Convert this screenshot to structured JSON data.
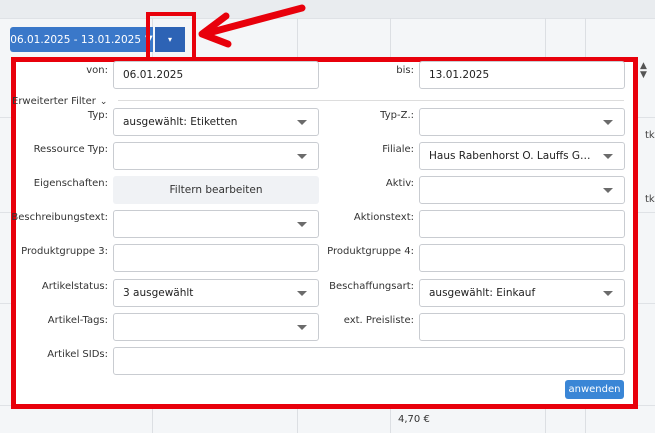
{
  "toolbar": {
    "date_range": "06.01.2025 - 13.01.2025",
    "funnel_icon": "▼",
    "caret_icon": "▾"
  },
  "background": {
    "right_text_1": "tk",
    "right_text_2": "tk",
    "price": "4,70 €"
  },
  "filter": {
    "von_label": "von:",
    "von_value": "06.01.2025",
    "bis_label": "bis:",
    "bis_value": "13.01.2025",
    "extended_label": "Erweiterter Filter",
    "typ_label": "Typ:",
    "typ_value": "ausgewählt: Etiketten",
    "typz_label": "Typ-Z.:",
    "typz_value": "",
    "ressource_label": "Ressource Typ:",
    "ressource_value": "",
    "filiale_label": "Filiale:",
    "filiale_value": "Haus Rabenhorst O. Lauffs GmbH &...",
    "eigenschaften_label": "Eigenschaften:",
    "filter_edit_button": "Filtern bearbeiten",
    "aktiv_label": "Aktiv:",
    "aktiv_value": "",
    "beschreibung_label": "Beschreibungstext:",
    "beschreibung_value": "",
    "aktionstext_label": "Aktionstext:",
    "aktionstext_value": "",
    "pg3_label": "Produktgruppe 3:",
    "pg3_value": "",
    "pg4_label": "Produktgruppe 4:",
    "pg4_value": "",
    "artikelstatus_label": "Artikelstatus:",
    "artikelstatus_value": "3 ausgewählt",
    "beschaffungsart_label": "Beschaffungsart:",
    "beschaffungsart_value": "ausgewählt: Einkauf",
    "tags_label": "Artikel-Tags:",
    "tags_value": "",
    "preisliste_label": "ext. Preisliste:",
    "preisliste_value": "",
    "sids_label": "Artikel SIDs:",
    "sids_value": "",
    "apply_button": "anwenden"
  },
  "colors": {
    "annotation_red": "#e8000b",
    "primary_blue": "#3a78c9"
  }
}
